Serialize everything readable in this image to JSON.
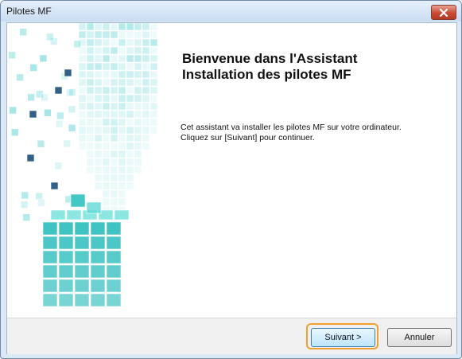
{
  "window": {
    "title": "Pilotes MF"
  },
  "titlebar": {
    "close_icon": "close-icon"
  },
  "main": {
    "title_line1": "Bienvenue dans l'Assistant",
    "title_line2": "Installation des pilotes MF",
    "body_line1": "Cet assistant va installer les pilotes MF sur votre ordinateur.",
    "body_line2": "Cliquez sur [Suivant] pour continuer."
  },
  "footer": {
    "next_label": "Suivant >",
    "cancel_label": "Annuler"
  },
  "colors": {
    "accent_highlight": "#f0a030",
    "cube_teal": "#2ec4c4"
  },
  "sidebar": {
    "image": "cube-graphic"
  }
}
